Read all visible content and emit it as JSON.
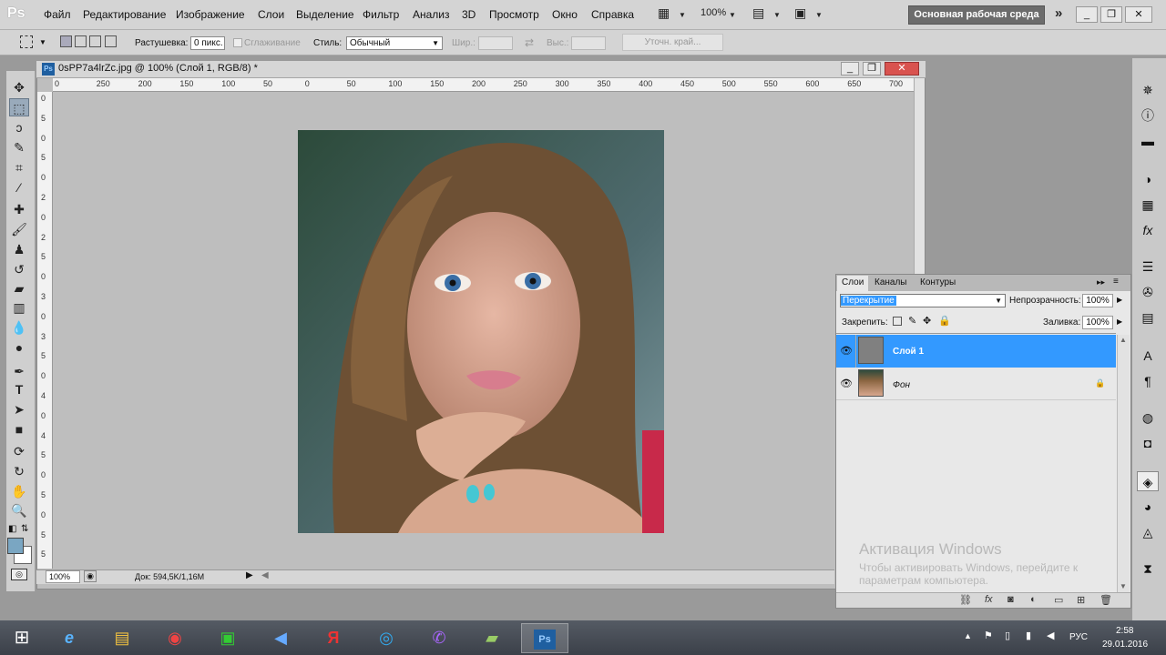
{
  "menubar": {
    "logo": "Ps",
    "items": [
      "Файл",
      "Редактирование",
      "Изображение",
      "Слои",
      "Выделение",
      "Фильтр",
      "Анализ",
      "3D",
      "Просмотр",
      "Окно",
      "Справка"
    ],
    "zoom": "100%",
    "workspace": "Основная рабочая среда",
    "more": "»"
  },
  "options": {
    "feather_label": "Растушевка:",
    "feather_value": "0 пикс.",
    "antialias_label": "Сглаживание",
    "style_label": "Стиль:",
    "style_value": "Обычный",
    "width_label": "Шир.:",
    "height_label": "Выс.:",
    "refine_label": "Уточн. край..."
  },
  "document": {
    "title": "0sPP7a4lrZc.jpg @ 100% (Слой 1, RGB/8) *",
    "ruler_h": [
      "0",
      "250",
      "200",
      "150",
      "100",
      "50",
      "0",
      "50",
      "100",
      "150",
      "200",
      "250",
      "300",
      "350",
      "400",
      "450",
      "500",
      "550",
      "600",
      "650",
      "700"
    ],
    "ruler_v": [
      "0",
      "5",
      "0",
      "5",
      "0",
      "2",
      "0",
      "2",
      "5",
      "0",
      "3",
      "0",
      "3",
      "5",
      "0",
      "4",
      "0",
      "4",
      "5",
      "0",
      "5",
      "0",
      "5",
      "5"
    ],
    "zoom": "100%",
    "info": "Док: 594,5K/1,16M"
  },
  "layers": {
    "tabs": [
      "Слои",
      "Каналы",
      "Контуры"
    ],
    "blend_mode": "Перекрытие",
    "opacity_label": "Непрозрачность:",
    "opacity_value": "100%",
    "lock_label": "Закрепить:",
    "fill_label": "Заливка:",
    "fill_value": "100%",
    "items": [
      {
        "name": "Слой 1",
        "selected": true
      },
      {
        "name": "Фон",
        "locked": true
      }
    ]
  },
  "watermark": {
    "title": "Активация Windows",
    "line1": "Чтобы активировать Windows, перейдите к",
    "line2": "параметрам компьютера."
  },
  "taskbar": {
    "lang": "РУС",
    "time": "2:58",
    "date": "29.01.2016"
  },
  "colors": {
    "selection": "#3399ff",
    "chrome": "#d4d4d4",
    "canvas_bg": "#bebebe",
    "fg_swatch": "#7aa6c2"
  }
}
